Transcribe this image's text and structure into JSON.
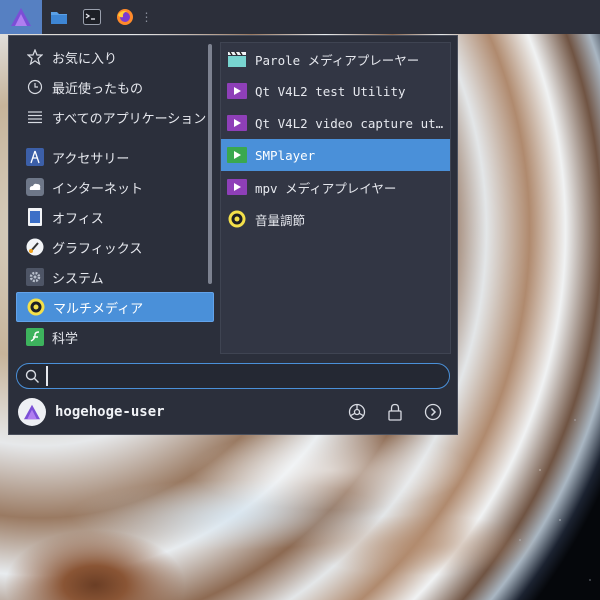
{
  "panel": {
    "launcher_icon": "xfce-logo-icon",
    "apps": [
      "file-manager-icon",
      "terminal-icon",
      "firefox-icon"
    ]
  },
  "menu": {
    "categories": [
      {
        "label": "お気に入り",
        "icon": "star-icon"
      },
      {
        "label": "最近使ったもの",
        "icon": "clock-icon"
      },
      {
        "label": "すべてのアプリケーション",
        "icon": "list-icon"
      },
      {
        "label": "アクセサリー",
        "icon": "compass-icon"
      },
      {
        "label": "インターネット",
        "icon": "cloud-icon"
      },
      {
        "label": "オフィス",
        "icon": "document-icon"
      },
      {
        "label": "グラフィックス",
        "icon": "brush-icon"
      },
      {
        "label": "システム",
        "icon": "gear-icon"
      },
      {
        "label": "マルチメディア",
        "icon": "media-disc-icon",
        "selected": true
      },
      {
        "label": "科学",
        "icon": "science-icon"
      }
    ],
    "apps": [
      {
        "label": "Parole メディアプレーヤー",
        "icon": "clapperboard-icon"
      },
      {
        "label": "Qt V4L2 test Utility",
        "icon": "play-icon"
      },
      {
        "label": "Qt V4L2 video capture uti…",
        "icon": "play-icon"
      },
      {
        "label": "SMPlayer",
        "icon": "smplayer-icon",
        "selected": true
      },
      {
        "label": "mpv メディアプレイヤー",
        "icon": "play-icon"
      },
      {
        "label": "音量調節",
        "icon": "volume-disc-icon"
      }
    ],
    "search": {
      "value": "",
      "placeholder": ""
    },
    "user": {
      "name": "hogehoge-user"
    },
    "actions": [
      "settings-icon",
      "lock-icon",
      "logout-icon"
    ]
  },
  "colors": {
    "accent": "#4a90d9",
    "panel_bg": "#2c2f3a",
    "menu_bg": "#2b2f3b"
  }
}
